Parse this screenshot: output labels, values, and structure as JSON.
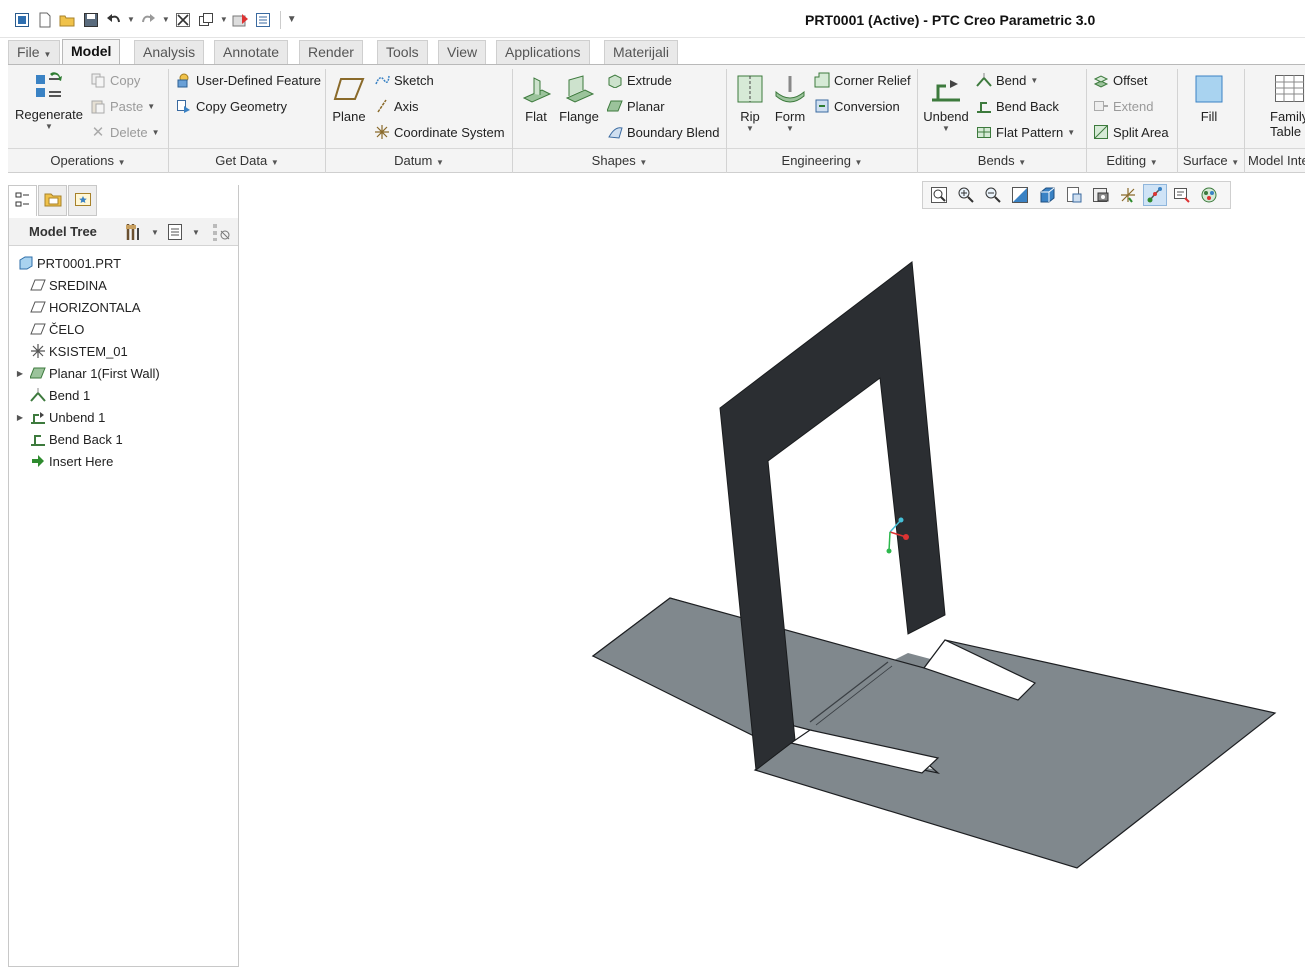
{
  "window": {
    "title": "PRT0001 (Active) - PTC Creo Parametric 3.0"
  },
  "quick_access": {
    "icons": [
      "app-menu-icon",
      "new-file-icon",
      "open-file-icon",
      "save-icon",
      "undo-icon",
      "redo-icon",
      "close-window-icon",
      "windows-icon",
      "regenerate-qat-icon",
      "switch-windows-icon",
      "customize-qat-icon"
    ]
  },
  "tabs": [
    {
      "label": "File",
      "active": false
    },
    {
      "label": "Model",
      "active": true
    },
    {
      "label": "Analysis",
      "active": false
    },
    {
      "label": "Annotate",
      "active": false
    },
    {
      "label": "Render",
      "active": false
    },
    {
      "label": "Tools",
      "active": false
    },
    {
      "label": "View",
      "active": false
    },
    {
      "label": "Applications",
      "active": false
    },
    {
      "label": "Materijali",
      "active": false
    }
  ],
  "ribbon": {
    "operations": {
      "group": "Operations",
      "regenerate": "Regenerate",
      "copy": "Copy",
      "paste": "Paste",
      "delete": "Delete"
    },
    "get_data": {
      "group": "Get Data",
      "udf": "User-Defined Feature",
      "copy_geometry": "Copy Geometry"
    },
    "datum": {
      "group": "Datum",
      "plane": "Plane",
      "sketch": "Sketch",
      "axis": "Axis",
      "csys": "Coordinate System"
    },
    "shapes": {
      "group": "Shapes",
      "flat": "Flat",
      "flange": "Flange",
      "extrude": "Extrude",
      "planar": "Planar",
      "boundary_blend": "Boundary Blend"
    },
    "engineering": {
      "group": "Engineering",
      "rip": "Rip",
      "form": "Form",
      "corner_relief": "Corner Relief",
      "conversion": "Conversion"
    },
    "bends": {
      "group": "Bends",
      "unbend": "Unbend",
      "bend": "Bend",
      "bend_back": "Bend Back",
      "flat_pattern": "Flat Pattern"
    },
    "editing": {
      "group": "Editing",
      "offset": "Offset",
      "extend": "Extend",
      "split_area": "Split Area"
    },
    "surface": {
      "group": "Surface",
      "fill": "Fill"
    },
    "model_intent": {
      "group": "Model Inte",
      "family_table_1": "Family",
      "family_table_2": "Table"
    }
  },
  "model_tree": {
    "header": "Model Tree",
    "items": [
      {
        "label": "PRT0001.PRT",
        "icon": "part-icon",
        "expandable": false
      },
      {
        "label": "SREDINA",
        "icon": "datum-plane-icon",
        "expandable": false
      },
      {
        "label": "HORIZONTALA",
        "icon": "datum-plane-icon",
        "expandable": false
      },
      {
        "label": "ČELO",
        "icon": "datum-plane-icon",
        "expandable": false
      },
      {
        "label": "KSISTEM_01",
        "icon": "csys-icon",
        "expandable": false
      },
      {
        "label": "Planar 1(First Wall)",
        "icon": "planar-wall-icon",
        "expandable": true
      },
      {
        "label": "Bend 1",
        "icon": "bend-icon",
        "expandable": false
      },
      {
        "label": "Unbend 1",
        "icon": "unbend-icon",
        "expandable": true
      },
      {
        "label": "Bend Back 1",
        "icon": "bend-back-icon",
        "expandable": false
      },
      {
        "label": "Insert Here",
        "icon": "insert-arrow-icon",
        "expandable": false
      }
    ]
  },
  "view_toolbar": {
    "icons": [
      "refit-icon",
      "zoom-in-icon",
      "zoom-out-icon",
      "repaint-icon",
      "display-style-icon",
      "saved-orientations-icon",
      "view-manager-icon",
      "datum-display-icon",
      "spin-center-icon",
      "annotation-display-icon",
      "appearance-icon"
    ],
    "active": "spin-center-icon"
  },
  "colors": {
    "part_dark": "#2b2e32",
    "part_flat": "#80888d",
    "accent_blue": "#3a82c4"
  }
}
